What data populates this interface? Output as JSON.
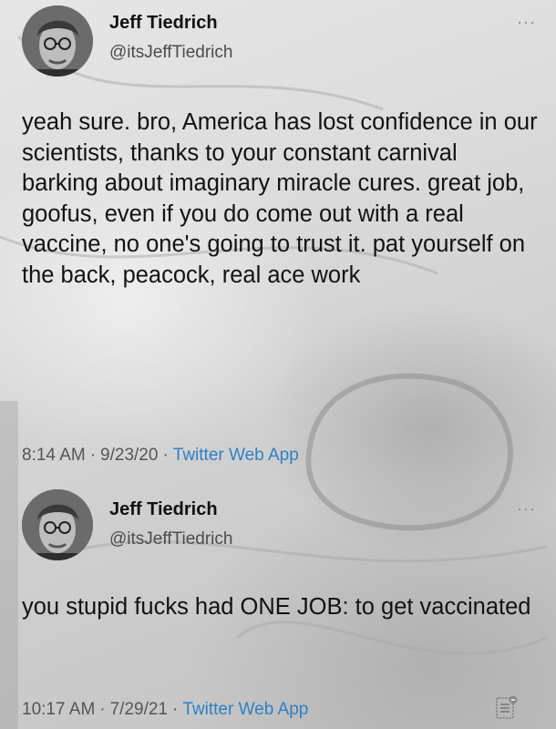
{
  "tweets": [
    {
      "author": {
        "name": "Jeff Tiedrich",
        "handle": "@itsJeffTiedrich"
      },
      "more_label": "···",
      "text": "yeah sure. bro, America has lost confidence in our scientists, thanks to your constant carnival barking about imaginary miracle cures. great job, goofus, even if you do come out with a real vaccine, no one's going to trust it. pat yourself on the back, peacock, real ace work",
      "time": "8:14 AM",
      "date": "9/23/20",
      "separator": "·",
      "source": "Twitter Web App"
    },
    {
      "author": {
        "name": "Jeff Tiedrich",
        "handle": "@itsJeffTiedrich"
      },
      "more_label": "···",
      "text": "you stupid fucks had ONE JOB: to get vaccinated",
      "time": "10:17 AM",
      "date": "7/29/21",
      "separator": "·",
      "source": "Twitter Web App"
    }
  ],
  "icons": {
    "avatar": "avatar-photo",
    "more": "more-options-icon",
    "corner": "document-icon"
  },
  "colors": {
    "link": "#2f7fc4",
    "text": "#121212",
    "secondary": "#555555"
  }
}
